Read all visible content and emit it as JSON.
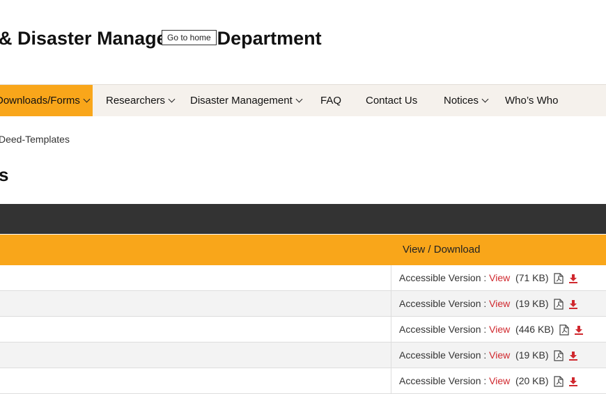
{
  "header": {
    "site_title": "& Disaster Management Department",
    "tooltip": "Go to home"
  },
  "nav": {
    "items": [
      {
        "label": "Downloads/Forms",
        "dropdown": true,
        "active": true
      },
      {
        "label": "Researchers",
        "dropdown": true
      },
      {
        "label": "Disaster Management",
        "dropdown": true
      },
      {
        "label": "FAQ",
        "dropdown": false
      },
      {
        "label": "Contact Us",
        "dropdown": false
      },
      {
        "label": "Notices",
        "dropdown": true
      },
      {
        "label": "Who’s Who",
        "dropdown": false
      }
    ]
  },
  "breadcrumb": "Deed-Templates",
  "page_title": "s",
  "table": {
    "header_col2": "View / Download",
    "rows": [
      {
        "prefix": "Accessible Version : ",
        "link": "View",
        "size": "(71 KB)"
      },
      {
        "prefix": "Accessible Version : ",
        "link": "View",
        "size": "(19 KB)"
      },
      {
        "prefix": "Accessible Version : ",
        "link": "View",
        "size": "(446 KB)"
      },
      {
        "prefix": "Accessible Version : ",
        "link": "View",
        "size": "(19 KB)"
      },
      {
        "prefix": "Accessible Version : ",
        "link": "View",
        "size": "(20 KB)"
      }
    ]
  },
  "colors": {
    "accent": "#f9a61a",
    "dark_bar": "#333333",
    "link": "#d0282e",
    "nav_bg": "#f5f1ec"
  },
  "icons": {
    "pdf": "pdf-file-icon",
    "download": "download-icon",
    "dropdown": "chevron-down-icon"
  }
}
